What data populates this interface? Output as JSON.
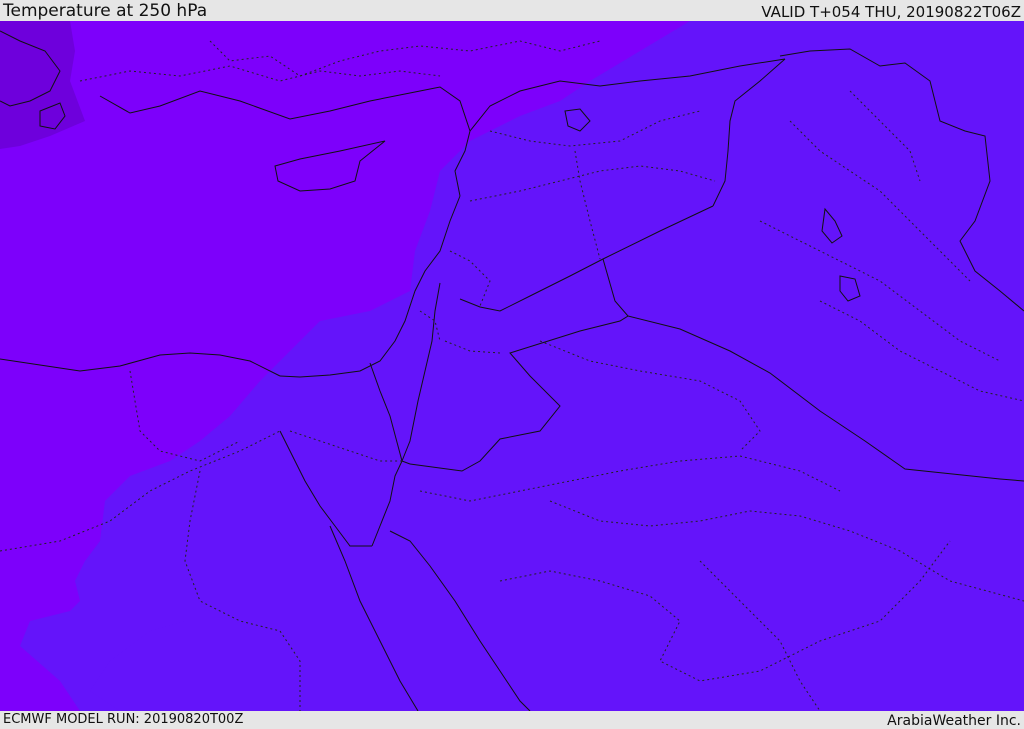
{
  "header": {
    "title": "Temperature at 250 hPa",
    "valid": "VALID T+054 THU, 20190822T06Z"
  },
  "footer": {
    "model_run": "ECMWF MODEL RUN: 20190820T00Z",
    "credit": "ArabiaWeather Inc."
  },
  "map": {
    "colors": {
      "temp_band_warm": "#6414fa",
      "temp_band_cold": "#7d00fb",
      "temp_band_coldest": "#6e00dc"
    }
  }
}
